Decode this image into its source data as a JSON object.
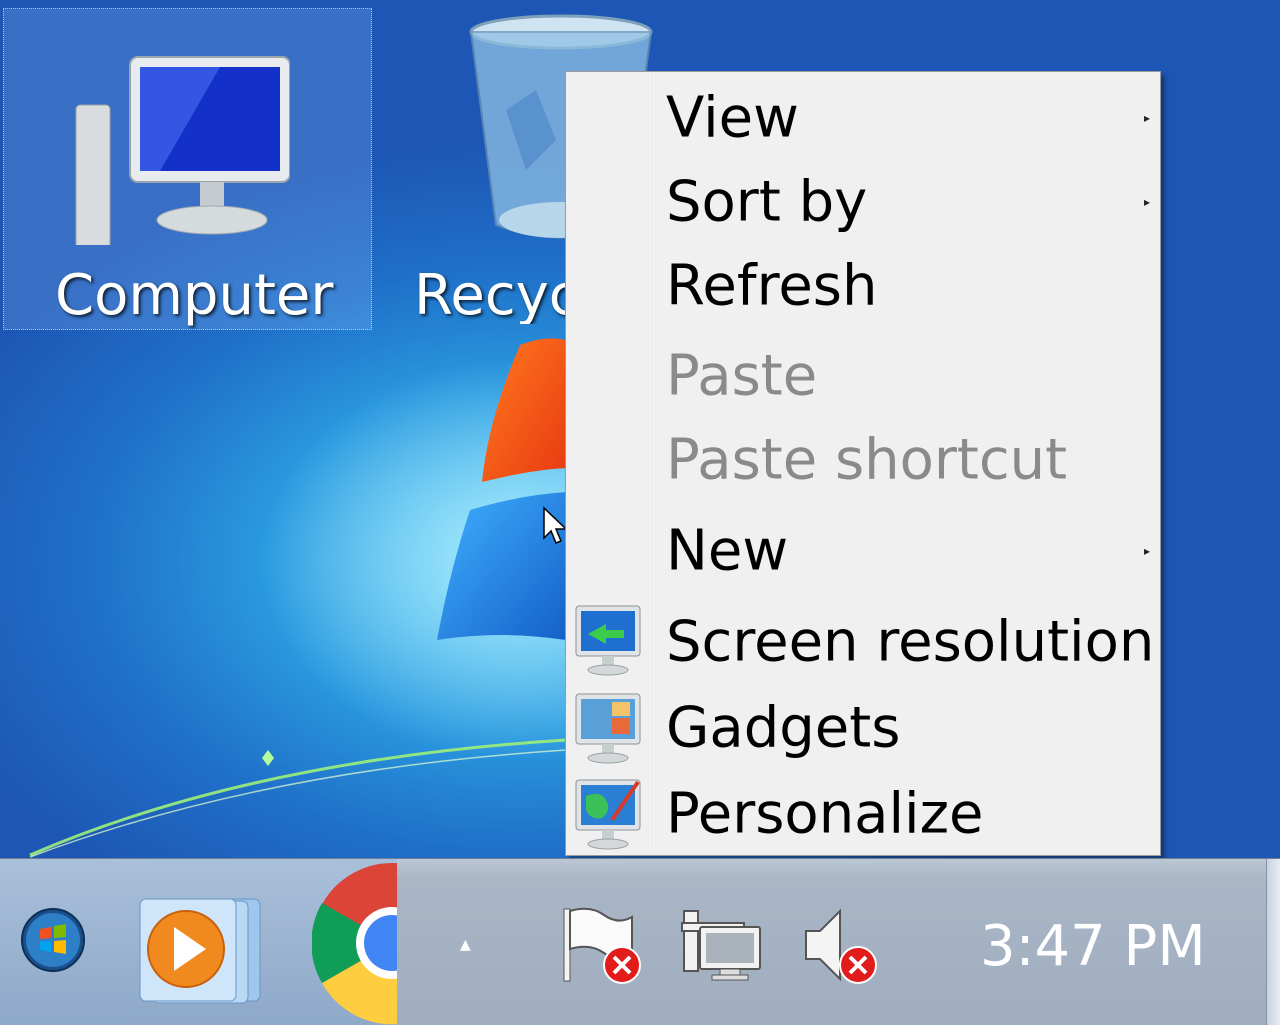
{
  "desktop": {
    "icons": [
      {
        "label": "Computer",
        "selected": true,
        "icon": "computer-icon"
      },
      {
        "label": "Recyc",
        "selected": false,
        "icon": "recycle-bin-icon"
      }
    ]
  },
  "context_menu": {
    "items": [
      {
        "label": "View",
        "submenu": true,
        "disabled": false
      },
      {
        "label": "Sort by",
        "submenu": true,
        "disabled": false
      },
      {
        "label": "Refresh",
        "submenu": false,
        "disabled": false
      },
      {
        "label": "Paste",
        "submenu": false,
        "disabled": true
      },
      {
        "label": "Paste shortcut",
        "submenu": false,
        "disabled": true
      },
      {
        "label": "New",
        "submenu": true,
        "disabled": false
      },
      {
        "label": "Screen resolution",
        "submenu": false,
        "disabled": false,
        "icon": "screen-resolution-icon"
      },
      {
        "label": "Gadgets",
        "submenu": false,
        "disabled": false,
        "icon": "gadgets-icon"
      },
      {
        "label": "Personalize",
        "submenu": false,
        "disabled": false,
        "icon": "personalize-icon"
      }
    ],
    "submenu_arrow": "▸"
  },
  "taskbar": {
    "pinned": [
      "start-orb-icon",
      "windows-media-player-icon",
      "chrome-icon"
    ],
    "show_hidden_icons": "▲",
    "tray_icons": [
      "action-center-flag-icon",
      "network-disconnected-icon",
      "volume-muted-icon"
    ],
    "clock": "3:47 PM"
  },
  "colors": {
    "menu_bg": "#f0f0f0",
    "disabled_text": "#8a8a8a",
    "taskbar": "#a9b6c6"
  }
}
